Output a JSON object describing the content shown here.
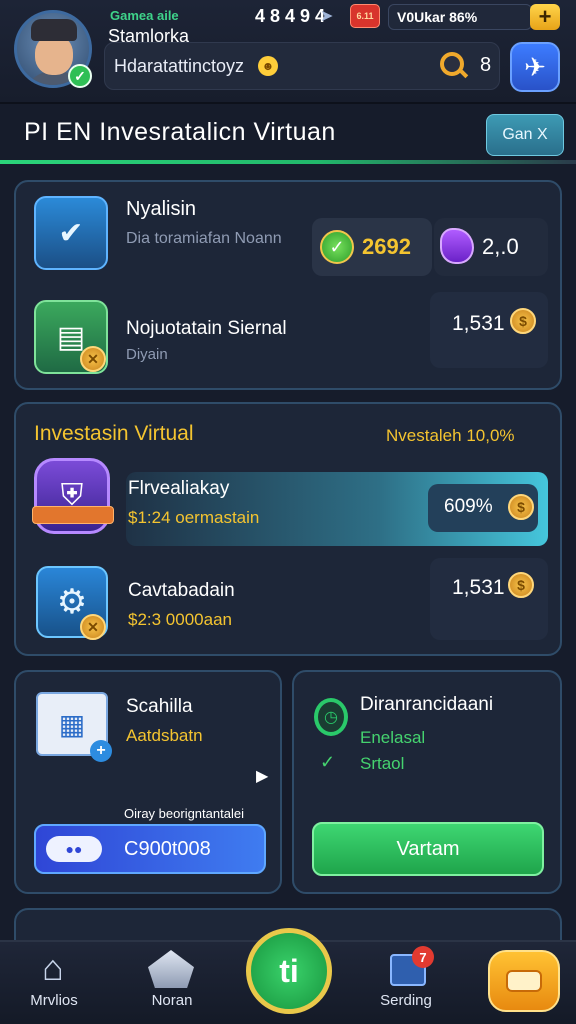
{
  "header": {
    "brand": "Gamea aile",
    "username": "Stamlorka",
    "stats_text": "4 8 4 9 4",
    "notif_badge": "6.11",
    "vcard_text": "V0Ukar  86%",
    "subtitle": "Hdaratattinctoyz",
    "count": "8"
  },
  "page": {
    "title": "PI EN Invesratalicn Virtuan",
    "gen_button": "Gan X"
  },
  "panel1": {
    "row1": {
      "title": "Nyalisin",
      "subtitle": "Dia toramiafan Noann",
      "value1": "2692",
      "value2": "2,.0"
    },
    "row2": {
      "title": "Nojuotatain Siernal",
      "subtitle": "Diyain",
      "value": "1,531"
    }
  },
  "panel2": {
    "heading": "Investasin Virtual",
    "heading_right": "Nvestaleh 10,0%",
    "row1": {
      "title": "Flrvealiakay",
      "subtitle": "$1:24 oermastain",
      "value": "609%"
    },
    "row2": {
      "title": "Cavtabadain",
      "subtitle": "$2:3 0000aan",
      "value": "1,531"
    }
  },
  "panel3": {
    "title": "Scahilla",
    "subtitle": "Aatdsbatn",
    "note": "Oiray beorigntantalei",
    "pill_value": "C900t008"
  },
  "panel4": {
    "title": "Diranrancidaani",
    "line1": "Enelasal",
    "line2": "Srtaol",
    "button": "Vartam"
  },
  "nav": {
    "item1": "Mrvlios",
    "item2": "Noran",
    "center": "ti",
    "item4": "Serding",
    "badge": "7"
  },
  "colors": {
    "accent_green": "#2bd47a",
    "gold": "#f4c430",
    "panel_border": "#2f4c69"
  }
}
